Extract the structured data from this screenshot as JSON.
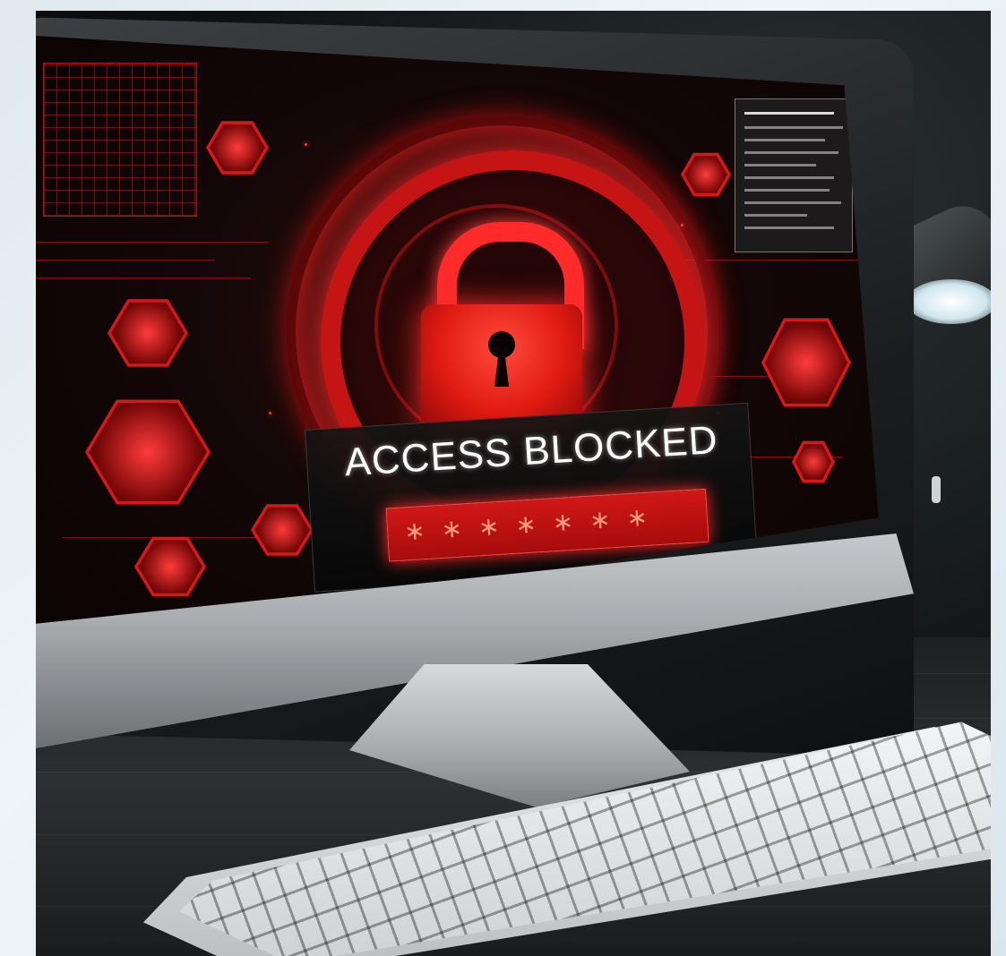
{
  "screen": {
    "title": "ACCESS BLOCKED",
    "password_mask": "∗∗∗∗∗∗∗"
  },
  "icons": [
    "lock-icon",
    "hexagon-icon",
    "grid-panel",
    "data-panel",
    "desk-lamp",
    "keyboard",
    "monitor"
  ],
  "colors": {
    "alert_red": "#e01b12",
    "glow_red": "#ff2a2a",
    "banner_bg": "#0e0e0e",
    "title_text": "#ffffff"
  }
}
